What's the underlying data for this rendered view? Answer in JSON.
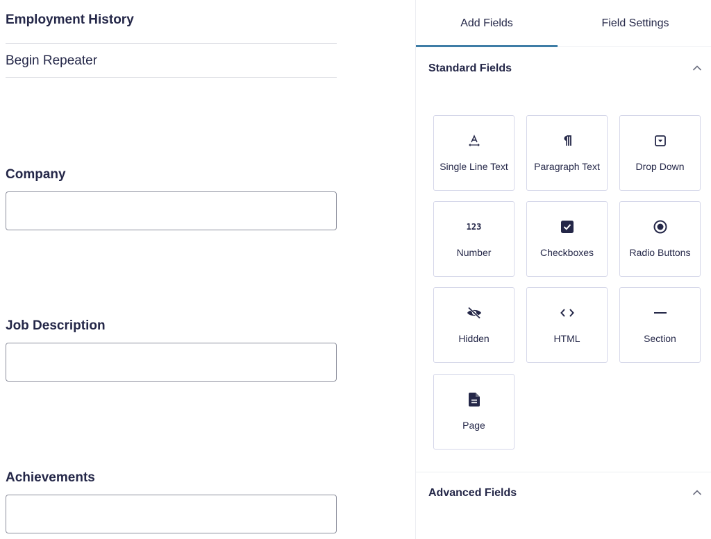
{
  "form": {
    "section_title": "Employment History",
    "repeater_label": "Begin Repeater",
    "fields": [
      {
        "label": "Company",
        "value": ""
      },
      {
        "label": "Job Description",
        "value": ""
      },
      {
        "label": "Achievements",
        "value": ""
      }
    ]
  },
  "sidebar": {
    "tabs": [
      {
        "label": "Add Fields",
        "active": true
      },
      {
        "label": "Field Settings",
        "active": false
      }
    ],
    "accent_color": "#3e7da6",
    "standard_fields": {
      "title": "Standard Fields",
      "expanded": true,
      "items": [
        {
          "label": "Single Line Text",
          "icon": "single-line-text-icon"
        },
        {
          "label": "Paragraph Text",
          "icon": "paragraph-icon"
        },
        {
          "label": "Drop Down",
          "icon": "dropdown-icon"
        },
        {
          "label": "Number",
          "icon": "number-icon",
          "icon_text": "123"
        },
        {
          "label": "Checkboxes",
          "icon": "checkbox-icon"
        },
        {
          "label": "Radio Buttons",
          "icon": "radio-icon"
        },
        {
          "label": "Hidden",
          "icon": "eye-slash-icon"
        },
        {
          "label": "HTML",
          "icon": "code-icon"
        },
        {
          "label": "Section",
          "icon": "minus-icon"
        },
        {
          "label": "Page",
          "icon": "document-icon"
        }
      ]
    },
    "advanced_fields": {
      "title": "Advanced Fields",
      "expanded": true
    }
  }
}
